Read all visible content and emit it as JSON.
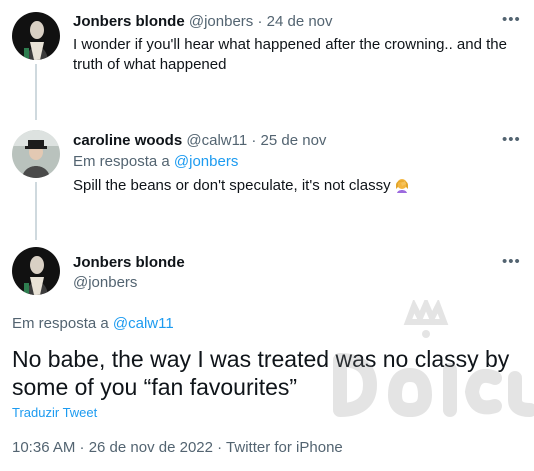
{
  "thread": [
    {
      "name": "Jonbers blonde",
      "handle": "@jonbers",
      "separator": "·",
      "date": "24 de nov",
      "text": "I wonder if you'll hear what happened after the crowning.. and the truth of what happened",
      "more_label": "•••"
    },
    {
      "name": "caroline woods",
      "handle": "@calw11",
      "separator": "·",
      "date": "25 de nov",
      "reply_prefix": "Em resposta a",
      "reply_to": "@jonbers",
      "text": "Spill the beans or don't speculate, it's not classy",
      "emoji": "woman-facepalming",
      "more_label": "•••"
    }
  ],
  "main_tweet": {
    "name": "Jonbers blonde",
    "handle": "@jonbers",
    "reply_prefix": "Em resposta a",
    "reply_to": "@calw11",
    "text": "No babe, the way I was treated was no classy by some of you “fan favourites”",
    "translate_label": "Traduzir Tweet",
    "timestamp": "10:36 AM · 26 de nov de 2022 · Twitter for iPhone",
    "more_label": "•••"
  },
  "icons": {
    "more": "more-horizontal-icon",
    "emoji": "woman-facepalming-emoji"
  },
  "colors": {
    "link": "#1d9bf0",
    "secondary_text": "#536471",
    "thread_line": "#cfd9de"
  }
}
